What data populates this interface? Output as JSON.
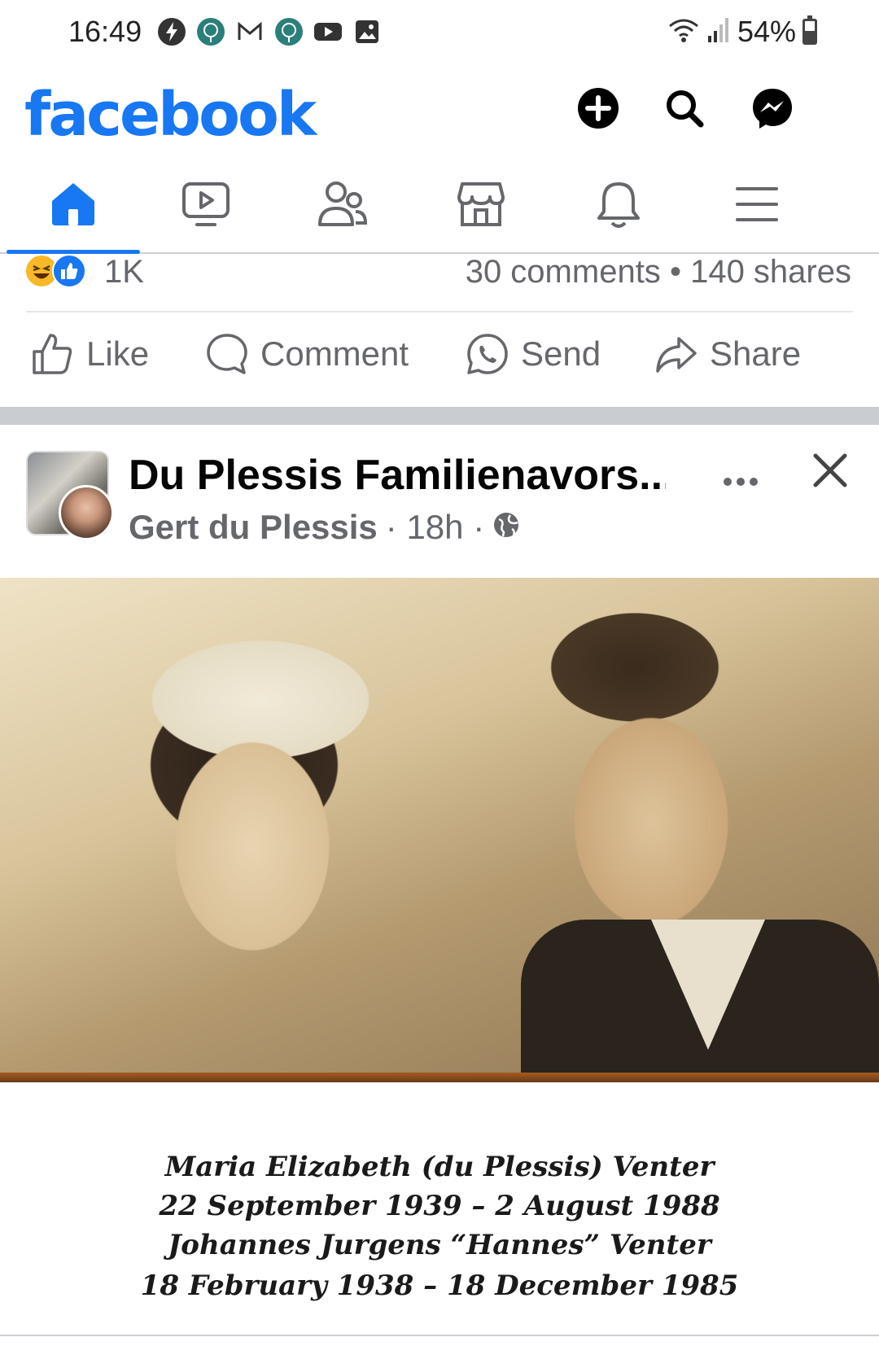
{
  "status_bar": {
    "time": "16:49",
    "battery": "54%",
    "battery_level": 0.54,
    "icons_left": [
      "power-saver-icon",
      "app-icon",
      "gmail-icon",
      "app-icon",
      "youtube-icon",
      "gallery-icon"
    ],
    "icons_right": [
      "wifi-icon",
      "signal-icon",
      "battery-icon"
    ]
  },
  "header": {
    "logo": "facebook",
    "brand_color": "#1877f2",
    "buttons": [
      "create-icon",
      "search-icon",
      "messenger-icon"
    ]
  },
  "nav": {
    "tabs": [
      {
        "name": "home",
        "icon": "home-icon",
        "active": true
      },
      {
        "name": "watch",
        "icon": "video-icon",
        "active": false
      },
      {
        "name": "friends",
        "icon": "friends-icon",
        "active": false
      },
      {
        "name": "marketplace",
        "icon": "marketplace-icon",
        "active": false
      },
      {
        "name": "notifications",
        "icon": "bell-icon",
        "active": false
      },
      {
        "name": "menu",
        "icon": "menu-icon",
        "active": false
      }
    ]
  },
  "previous_post": {
    "reaction_count": "1K",
    "comments": "30 comments",
    "separator": "•",
    "shares": "140 shares",
    "actions": {
      "like": "Like",
      "comment": "Comment",
      "send": "Send",
      "share": "Share"
    }
  },
  "post": {
    "group_name": "Du Plessis Familienavors...",
    "author": "Gert du Plessis",
    "time": "· 18h ·",
    "privacy_icon": "globe-icon",
    "caption_lines": [
      "Maria Elizabeth (du Plessis) Venter",
      "22 September 1939 – 2 August 1988",
      "Johannes Jurgens “Hannes” Venter",
      "18 February 1938 – 18 December 1985"
    ]
  }
}
